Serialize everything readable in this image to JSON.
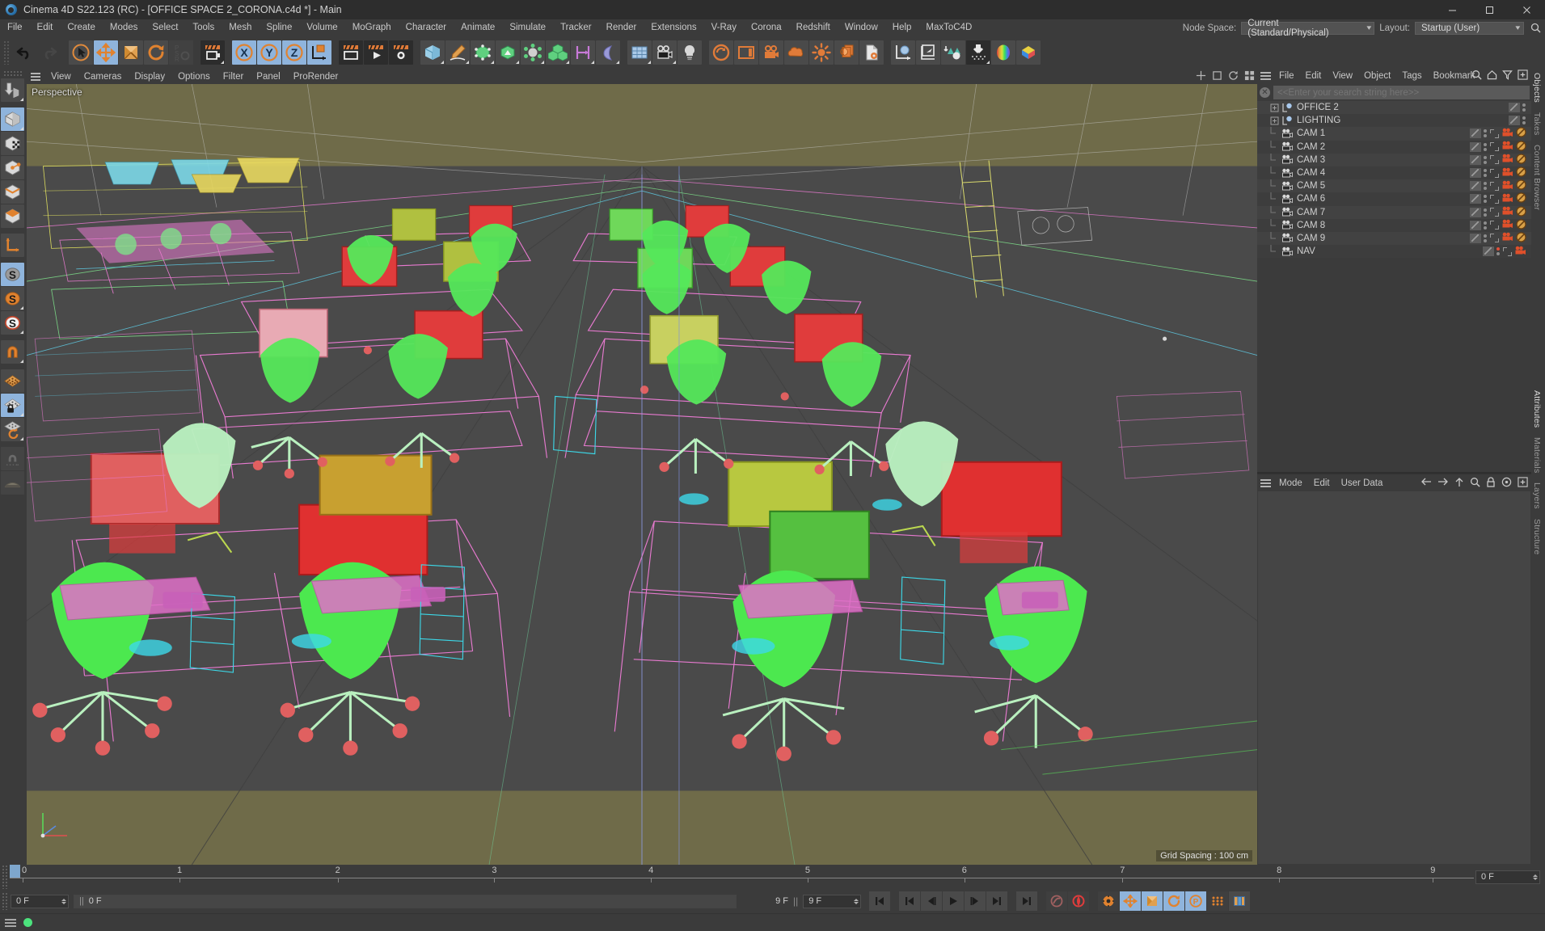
{
  "window": {
    "title": "Cinema 4D S22.123 (RC) - [OFFICE SPACE 2_CORONA.c4d *] - Main",
    "logo_icon": "cinema4d-logo-icon",
    "minimize_label": "Minimize",
    "maximize_label": "Maximize",
    "close_label": "Close"
  },
  "menubar": {
    "items": [
      "File",
      "Edit",
      "Create",
      "Modes",
      "Select",
      "Tools",
      "Mesh",
      "Spline",
      "Volume",
      "MoGraph",
      "Character",
      "Animate",
      "Simulate",
      "Tracker",
      "Render",
      "Extensions",
      "V-Ray",
      "Corona",
      "Redshift",
      "Window",
      "Help",
      "MaxToC4D"
    ],
    "node_space_label": "Node Space:",
    "node_space_value": "Current (Standard/Physical)",
    "layout_label": "Layout:",
    "layout_value": "Startup (User)",
    "search_icon": "search-icon"
  },
  "toolbar": {
    "groups": [
      {
        "name": "history",
        "buttons": [
          {
            "icon": "undo-icon",
            "label": "Undo",
            "state": "normal"
          },
          {
            "icon": "redo-icon",
            "label": "Redo",
            "state": "dim"
          }
        ]
      },
      {
        "name": "transform",
        "buttons": [
          {
            "icon": "select-cursor-icon",
            "label": "Live Selection",
            "state": "normal"
          },
          {
            "icon": "move-icon",
            "label": "Move",
            "state": "active"
          },
          {
            "icon": "scale-icon",
            "label": "Scale",
            "state": "normal"
          },
          {
            "icon": "rotate-icon",
            "label": "Rotate",
            "state": "normal"
          },
          {
            "icon": "psr-icon",
            "label": "PSR",
            "state": "dim"
          }
        ]
      },
      {
        "name": "render-quick",
        "buttons": [
          {
            "icon": "render-view-clapper-icon",
            "label": "Render View",
            "state": "dark"
          }
        ]
      },
      {
        "name": "axis-locks",
        "buttons": [
          {
            "icon": "x-axis-icon",
            "label": "X Axis",
            "state": "active"
          },
          {
            "icon": "y-axis-icon",
            "label": "Y Axis",
            "state": "active"
          },
          {
            "icon": "z-axis-icon",
            "label": "Z Axis",
            "state": "active"
          },
          {
            "icon": "world-coordinate-icon",
            "label": "World/Object Coordinate System",
            "state": "normal"
          }
        ]
      },
      {
        "name": "render-group",
        "buttons": [
          {
            "icon": "render-to-viewport-icon",
            "label": "Render View",
            "state": "dark"
          },
          {
            "icon": "render-to-picture-viewer-icon",
            "label": "Render to Picture Viewer",
            "state": "dark"
          },
          {
            "icon": "render-settings-icon",
            "label": "Edit Render Settings",
            "state": "dark"
          }
        ]
      },
      {
        "name": "create",
        "buttons": [
          {
            "icon": "cube-primitive-icon",
            "label": "Add Cube Object",
            "state": "normal"
          },
          {
            "icon": "pen-spline-icon",
            "label": "Add Spline",
            "state": "normal"
          },
          {
            "icon": "generator-icon",
            "label": "Add Generator",
            "state": "normal"
          },
          {
            "icon": "bend-deformer-icon",
            "label": "Add Deformer",
            "state": "normal"
          },
          {
            "icon": "scene-node-icon",
            "label": "Add Scene Object",
            "state": "normal"
          },
          {
            "icon": "mograph-cloner-icon",
            "label": "MoGraph Cloner",
            "state": "normal"
          },
          {
            "icon": "measure-icon",
            "label": "Measure",
            "state": "normal"
          },
          {
            "icon": "field-icon",
            "label": "Add Field",
            "state": "normal"
          }
        ]
      },
      {
        "name": "deform",
        "buttons": [
          {
            "icon": "subdivision-surface-icon",
            "label": "Subdivision Surface",
            "state": "normal"
          },
          {
            "icon": "camera-icon",
            "label": "Add Camera",
            "state": "normal"
          },
          {
            "icon": "light-icon",
            "label": "Add Light",
            "state": "normal"
          }
        ]
      },
      {
        "name": "corona",
        "buttons": [
          {
            "icon": "corona-render-icon",
            "label": "Corona Render",
            "state": "normal"
          },
          {
            "icon": "corona-frame-buffer-icon",
            "label": "Corona Frame Buffer",
            "state": "normal"
          },
          {
            "icon": "corona-camera-icon",
            "label": "Corona Camera",
            "state": "normal"
          },
          {
            "icon": "corona-volume-icon",
            "label": "Corona Volume Material",
            "state": "normal"
          },
          {
            "icon": "corona-sun-icon",
            "label": "Corona Sun",
            "state": "normal"
          },
          {
            "icon": "corona-light-material-icon",
            "label": "Corona Light Material",
            "state": "normal"
          },
          {
            "icon": "corona-settings-icon",
            "label": "Corona Settings",
            "state": "normal"
          }
        ]
      },
      {
        "name": "tools",
        "buttons": [
          {
            "icon": "axis-sphere-icon",
            "label": "Workplane",
            "state": "normal"
          },
          {
            "icon": "arrow-plane-icon",
            "label": "Workplane Tool",
            "state": "normal"
          },
          {
            "icon": "polygon-reduce-icon",
            "label": "Polygon Reduction",
            "state": "normal"
          },
          {
            "icon": "project-to-ground-icon",
            "label": "Project",
            "state": "dark"
          },
          {
            "icon": "color-wheel-icon",
            "label": "Color Picker",
            "state": "normal"
          },
          {
            "icon": "material-icon",
            "label": "Materials",
            "state": "normal"
          }
        ]
      }
    ]
  },
  "left_toolbar": {
    "buttons": [
      {
        "icon": "make-editable-icon",
        "label": "Make Editable",
        "state": "normal"
      },
      {
        "icon": "model-mode-icon",
        "label": "Model Mode",
        "state": "active"
      },
      {
        "icon": "texture-mode-icon",
        "label": "Texture Mode",
        "state": "normal"
      },
      {
        "icon": "points-mode-icon",
        "label": "Points Mode",
        "state": "normal"
      },
      {
        "icon": "edges-mode-icon",
        "label": "Edges Mode",
        "state": "normal"
      },
      {
        "icon": "polygons-mode-icon",
        "label": "Polygons Mode",
        "state": "normal"
      },
      {
        "icon": "axis-mode-icon",
        "label": "Enable Axis Modification",
        "state": "normal"
      },
      {
        "icon": "world-axis-s-icon",
        "label": "Object/World Coordinate",
        "state": "active"
      },
      {
        "icon": "object-axis-s-icon",
        "label": "Object Axis",
        "state": "normal"
      },
      {
        "icon": "viewport-solo-s-icon",
        "label": "Viewport Solo",
        "state": "normal"
      },
      {
        "icon": "magnet-icon",
        "label": "Magnet",
        "state": "normal"
      },
      {
        "icon": "snap-enable-icon",
        "label": "Enable Snapping",
        "state": "normal"
      },
      {
        "icon": "snap-lock-icon",
        "label": "Lock Workplane",
        "state": "active"
      },
      {
        "icon": "snap-rotate-icon",
        "label": "Workplane Rotate",
        "state": "normal"
      },
      {
        "icon": "deformer-magnet-icon",
        "label": "Deform Tool",
        "state": "normal"
      },
      {
        "icon": "workplane-icon",
        "label": "Workplane",
        "state": "normal"
      }
    ]
  },
  "viewport": {
    "header_items": [
      "View",
      "Cameras",
      "Display",
      "Options",
      "Filter",
      "Panel",
      "ProRender"
    ],
    "burger_icon": "hamburger-icon",
    "label": "Perspective",
    "grid_spacing": "Grid Spacing : 100 cm",
    "right_icons": [
      "viewport-axis-icon",
      "viewport-fullscreen-icon",
      "viewport-rotate-icon",
      "viewport-layout-icon"
    ],
    "axis_gizmo": "axis-gizmo-icon"
  },
  "object_manager": {
    "burger_icon": "hamburger-icon",
    "menu_items": [
      "File",
      "Edit",
      "View",
      "Object",
      "Tags",
      "Bookmark"
    ],
    "icons": [
      "search-icon",
      "home-icon",
      "filter-icon",
      "add-panel-icon"
    ],
    "search_placeholder": "<<Enter your search string here>>",
    "search_value": "",
    "clear_icon": "clear-search-icon",
    "objects": [
      {
        "name": "OFFICE 2",
        "icon": "null-object-icon",
        "expandable": true,
        "child": false,
        "tags": [
          "visibility-dots"
        ]
      },
      {
        "name": "LIGHTING",
        "icon": "null-object-icon",
        "expandable": true,
        "child": false,
        "tags": [
          "visibility-dots"
        ]
      },
      {
        "name": "CAM 1",
        "icon": "camera-object-icon",
        "expandable": false,
        "child": true,
        "tags": [
          "visibility-dots",
          "protection",
          "camera-tag",
          "disabled-tag"
        ]
      },
      {
        "name": "CAM 2",
        "icon": "camera-object-icon",
        "expandable": false,
        "child": true,
        "tags": [
          "visibility-dots",
          "protection",
          "camera-tag",
          "disabled-tag"
        ]
      },
      {
        "name": "CAM 3",
        "icon": "camera-object-icon",
        "expandable": false,
        "child": true,
        "tags": [
          "visibility-dots",
          "protection",
          "camera-tag",
          "disabled-tag"
        ]
      },
      {
        "name": "CAM 4",
        "icon": "camera-object-icon",
        "expandable": false,
        "child": true,
        "tags": [
          "visibility-dots",
          "protection",
          "camera-tag",
          "disabled-tag"
        ]
      },
      {
        "name": "CAM 5",
        "icon": "camera-object-icon",
        "expandable": false,
        "child": true,
        "tags": [
          "visibility-dots",
          "protection",
          "camera-tag",
          "disabled-tag"
        ]
      },
      {
        "name": "CAM 6",
        "icon": "camera-object-icon",
        "expandable": false,
        "child": true,
        "tags": [
          "visibility-dots",
          "protection",
          "camera-tag",
          "disabled-tag"
        ]
      },
      {
        "name": "CAM 7",
        "icon": "camera-object-icon",
        "expandable": false,
        "child": true,
        "tags": [
          "visibility-dots",
          "protection",
          "camera-tag",
          "disabled-tag"
        ]
      },
      {
        "name": "CAM 8",
        "icon": "camera-object-icon",
        "expandable": false,
        "child": true,
        "tags": [
          "visibility-dots",
          "protection",
          "camera-tag",
          "disabled-tag"
        ]
      },
      {
        "name": "CAM 9",
        "icon": "camera-object-icon",
        "expandable": false,
        "child": true,
        "tags": [
          "visibility-dots",
          "protection",
          "camera-tag",
          "disabled-tag"
        ]
      },
      {
        "name": "NAV",
        "icon": "camera-object-icon",
        "expandable": false,
        "child": true,
        "tags": [
          "visibility-dots-red",
          "protection",
          "camera-tag"
        ]
      }
    ]
  },
  "attributes_panel": {
    "burger_icon": "hamburger-icon",
    "menu_items": [
      "Mode",
      "Edit",
      "User Data"
    ],
    "icons": [
      "back-arrow-icon",
      "forward-arrow-icon",
      "up-arrow-icon",
      "search-icon",
      "lock-icon",
      "target-icon",
      "add-panel-icon"
    ]
  },
  "dock_tabs": {
    "top": [
      "Objects",
      "Takes",
      "Content Browser"
    ],
    "bottom": [
      "Attributes",
      "Materials",
      "Layers",
      "Structure"
    ]
  },
  "timeline": {
    "ticks": [
      "0",
      "1",
      "2",
      "3",
      "4",
      "5",
      "6",
      "7",
      "8",
      "9"
    ],
    "current_frame": 0,
    "end_frame_field": "0 F",
    "preview_min": "0 F",
    "preview_max": "9 F",
    "frame_field_right": "9 F"
  },
  "bottom_bar": {
    "frame_current": "0 F",
    "frame_preview": "0 F",
    "frame_end": "9 F",
    "frame_max": "9 F",
    "transport": [
      {
        "icon": "go-to-start-icon",
        "label": "Go to Start"
      },
      {
        "icon": "previous-key-icon",
        "label": "Go to Previous Key"
      },
      {
        "icon": "step-back-icon",
        "label": "Go to Previous Frame"
      },
      {
        "icon": "play-icon",
        "label": "Play Forwards"
      },
      {
        "icon": "step-forward-icon",
        "label": "Go to Next Frame"
      },
      {
        "icon": "next-key-icon",
        "label": "Go to Next Key"
      },
      {
        "icon": "go-to-end-icon",
        "label": "Go to End"
      }
    ],
    "record_group": [
      {
        "icon": "autokey-icon",
        "label": "Autokeying",
        "state": "dim"
      },
      {
        "icon": "record-icon",
        "label": "Record Active Objects",
        "state": "normal"
      }
    ],
    "key_group": [
      {
        "icon": "keyframe-settings-icon",
        "label": "Animation Settings",
        "state": "dark"
      },
      {
        "icon": "position-key-icon",
        "label": "Record Position",
        "state": "active"
      },
      {
        "icon": "scale-key-icon",
        "label": "Record Scale",
        "state": "active"
      },
      {
        "icon": "rotation-key-icon",
        "label": "Record Rotation",
        "state": "active"
      },
      {
        "icon": "pla-key-icon",
        "label": "Record PLA",
        "state": "active"
      },
      {
        "icon": "point-level-anim-icon",
        "label": "Point Level Animation",
        "state": "dark"
      },
      {
        "icon": "keyframe-mode-icon",
        "label": "Keyframe Selection",
        "state": "normal"
      }
    ]
  },
  "status_bar": {
    "burger_icon": "hamburger-icon",
    "status_dot_color": "#4ce37d",
    "message": ""
  },
  "colors": {
    "accent_blue": "#8fb4dc",
    "panel_bg": "#3b3b3b",
    "viewport_bg": "#4a4a4a",
    "orange": "#e07b39",
    "green_status": "#4ce37d"
  }
}
